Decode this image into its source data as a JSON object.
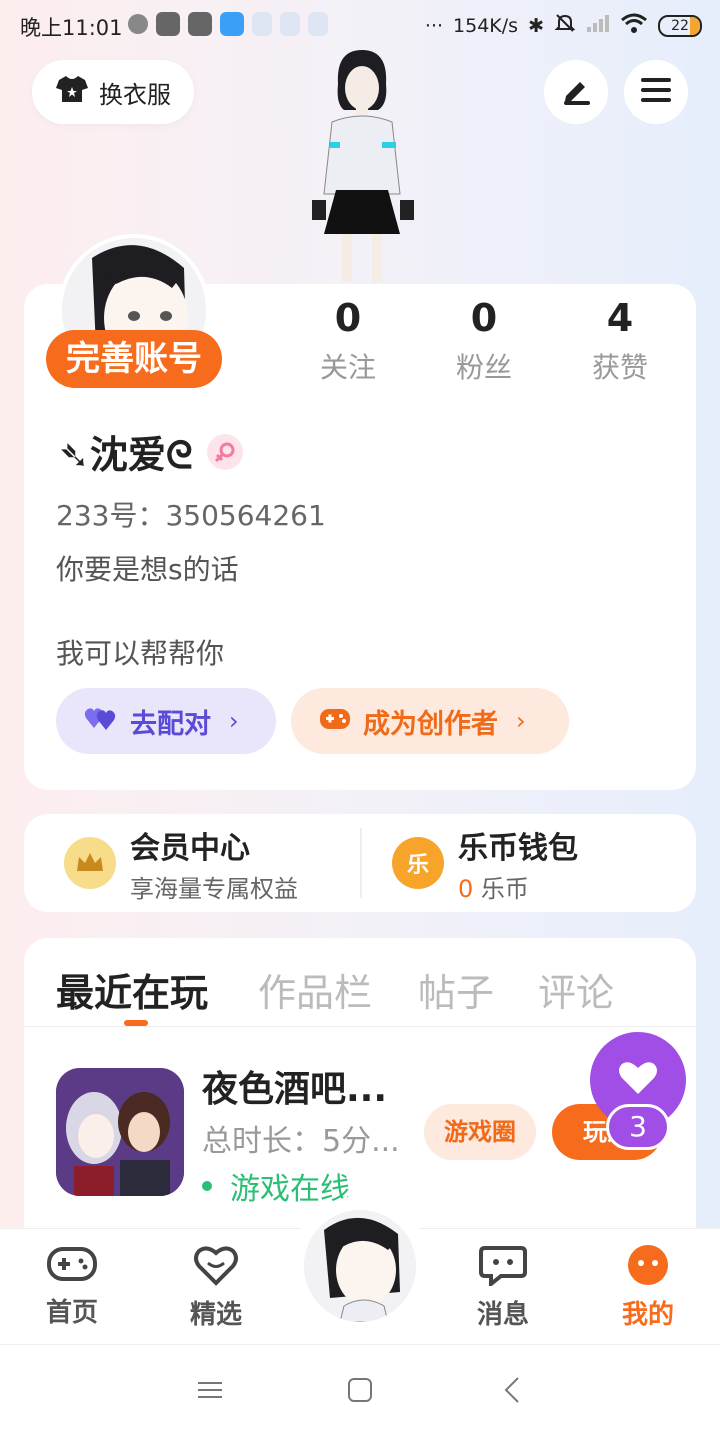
{
  "status_bar": {
    "time": "晚上11:01",
    "net_speed": "154K/s",
    "battery": "22"
  },
  "header": {
    "outfit_label": "换衣服",
    "icons": [
      "shirt-icon",
      "edit-icon",
      "menu-icon"
    ]
  },
  "profile": {
    "complete_account_label": "完善账号",
    "stats": [
      {
        "value": "0",
        "label": "关注"
      },
      {
        "value": "0",
        "label": "粉丝"
      },
      {
        "value": "4",
        "label": "获赞"
      }
    ],
    "username": "➴沈爱ᘓ",
    "id_line": "233号：350564261",
    "bio_line1": "你要是想s的话",
    "bio_line2": "我可以帮帮你",
    "pair_label": "去配对",
    "creator_label": "成为创作者"
  },
  "wallet": {
    "member_title": "会员中心",
    "member_sub": "享海量专属权益",
    "coin_title": "乐币钱包",
    "coin_amount": "0",
    "coin_unit": "乐币",
    "coin_glyph": "乐"
  },
  "tabs": [
    "最近在玩",
    "作品栏",
    "帖子",
    "评论"
  ],
  "game": {
    "title": "夜色酒吧...",
    "playtime": "总时长：5分...",
    "status": "游戏在线",
    "circle_label": "游戏圈",
    "play_label": "玩游",
    "like_count": "3"
  },
  "bottom_nav": [
    {
      "label": "首页",
      "icon": "gamepad-icon"
    },
    {
      "label": "精选",
      "icon": "heart-chat-icon"
    },
    {
      "label": "消息",
      "icon": "message-icon"
    },
    {
      "label": "我的",
      "icon": "profile-face-icon"
    }
  ],
  "colors": {
    "accent": "#f76b1c",
    "purple": "#a14ee6",
    "online": "#2bbf75"
  }
}
